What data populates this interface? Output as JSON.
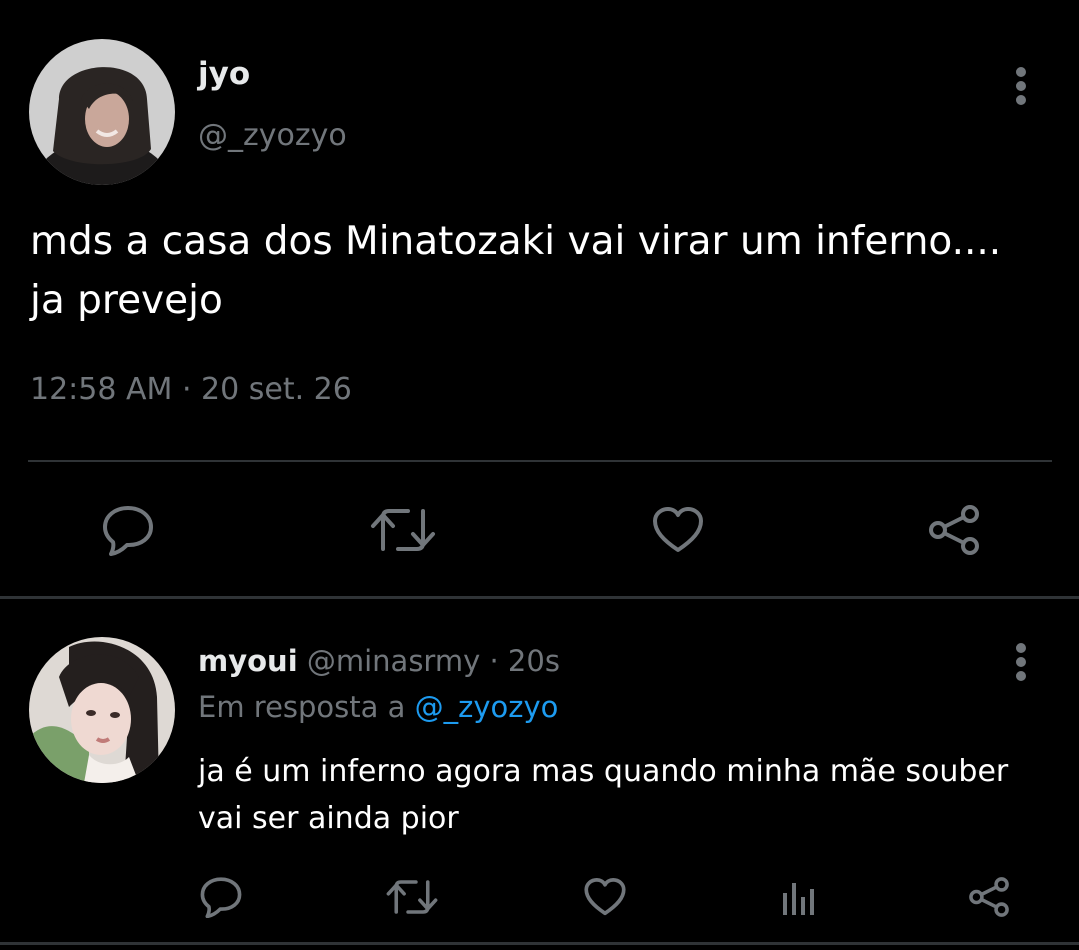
{
  "main_tweet": {
    "display_name": "jyo",
    "handle": "@_zyozyo",
    "text": "mds a casa dos Minatozaki vai virar um inferno.... ja prevejo",
    "time": "12:58 AM",
    "separator": "·",
    "date": "20 set. 26",
    "avatar_icon": "profile-photo",
    "more_icon": "vertical-ellipsis-icon",
    "actions": [
      "reply-icon",
      "retweet-icon",
      "like-icon",
      "share-icon"
    ]
  },
  "reply": {
    "display_name": "myoui",
    "handle": "@minasrmy",
    "separator": "·",
    "time": "20s",
    "replying_to_label": "Em resposta a",
    "replying_to_handle": "@_zyozyo",
    "text": "ja é um inferno agora mas quando minha mãe souber vai ser ainda pior",
    "avatar_icon": "profile-photo",
    "more_icon": "vertical-ellipsis-icon",
    "actions": [
      "reply-icon",
      "retweet-icon",
      "like-icon",
      "analytics-icon",
      "share-icon"
    ]
  },
  "colors": {
    "background": "#000000",
    "text_primary": "#e7e9ea",
    "text_secondary": "#71767b",
    "link": "#1d9bf0",
    "divider": "#2f3336"
  }
}
